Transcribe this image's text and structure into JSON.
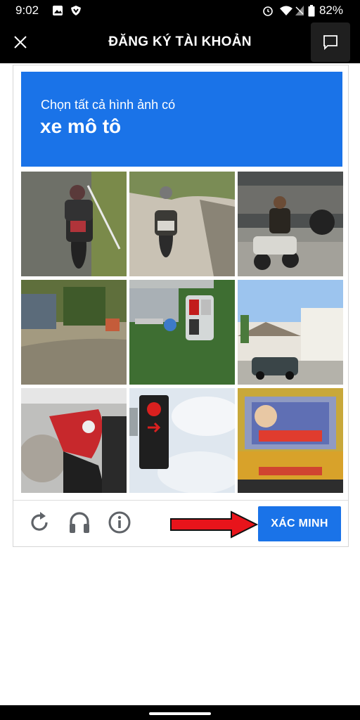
{
  "status_bar": {
    "time": "9:02",
    "battery": "82%"
  },
  "app_bar": {
    "title": "ĐĂNG KÝ TÀI KHOẢN",
    "close_icon": "close-icon",
    "chat_icon": "chat-icon"
  },
  "captcha": {
    "instruction": "Chọn tất cả hình ảnh có",
    "target": "xe mô tô",
    "tiles": [
      {
        "subject": "motorcycle"
      },
      {
        "subject": "motorcycle"
      },
      {
        "subject": "motorcycle"
      },
      {
        "subject": "street"
      },
      {
        "subject": "traffic light"
      },
      {
        "subject": "house"
      },
      {
        "subject": "motorcycle"
      },
      {
        "subject": "traffic light"
      },
      {
        "subject": "truck"
      }
    ],
    "verify_label": "XÁC MINH",
    "icons": [
      "reload-icon",
      "headphones-icon",
      "info-icon",
      "red-arrow-icon"
    ],
    "accent_color": "#1a73e8",
    "arrow_color": "#e8141b"
  }
}
